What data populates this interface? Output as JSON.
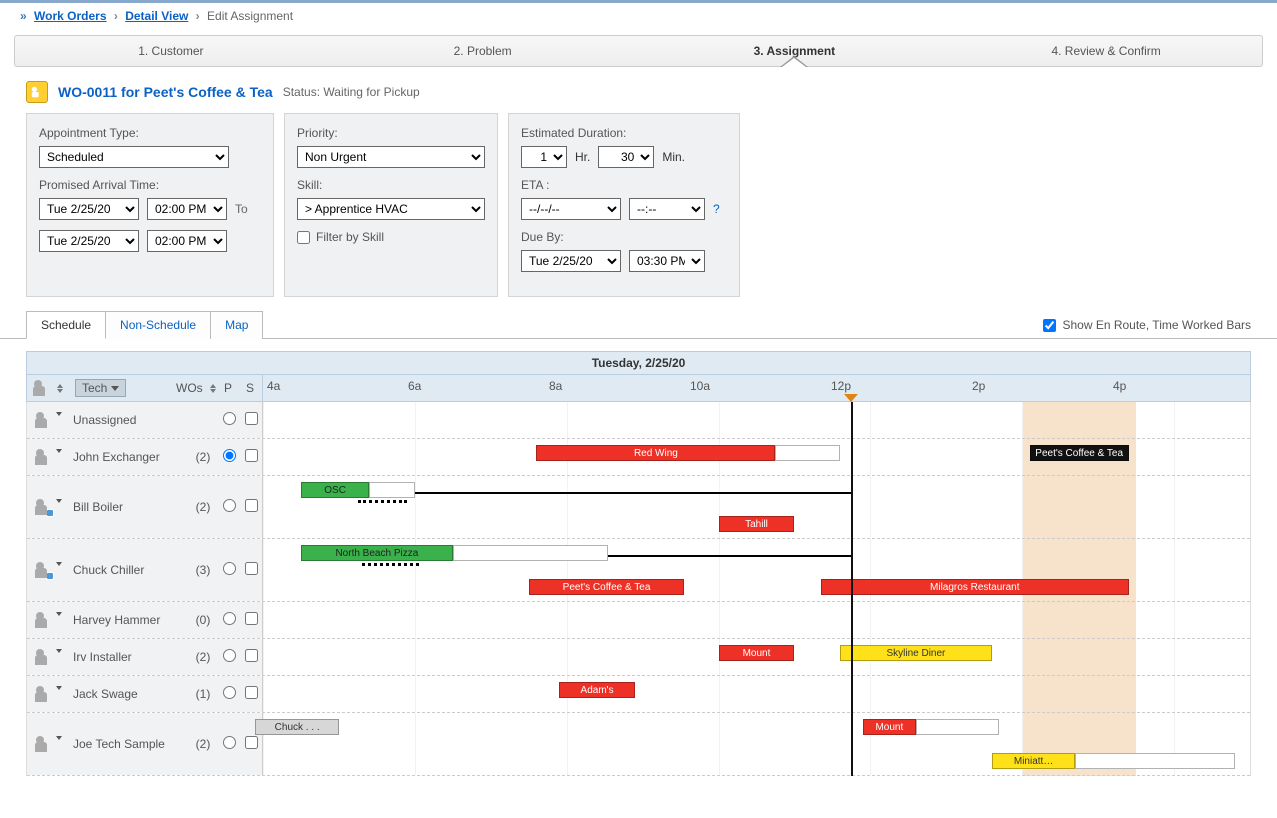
{
  "breadcrumbs": {
    "items": [
      {
        "label": "Work Orders",
        "link": true
      },
      {
        "label": "Detail View",
        "link": true
      },
      {
        "label": "Edit Assignment",
        "link": false
      }
    ]
  },
  "steps": {
    "items": [
      {
        "label": "1. Customer"
      },
      {
        "label": "2. Problem"
      },
      {
        "label": "3. Assignment",
        "active": true
      },
      {
        "label": "4. Review & Confirm"
      }
    ]
  },
  "work_order": {
    "title": "WO-0011 for Peet's Coffee & Tea",
    "status_label": "Status:",
    "status_value": "Waiting for Pickup"
  },
  "panels": {
    "appointment": {
      "type_label": "Appointment Type:",
      "type_value": "Scheduled",
      "arrival_label": "Promised Arrival Time:",
      "from_date": "Tue 2/25/20",
      "from_time": "02:00 PM",
      "to_label": "To",
      "to_date": "Tue 2/25/20",
      "to_time": "02:00 PM"
    },
    "priority": {
      "priority_label": "Priority:",
      "priority_value": "Non Urgent",
      "skill_label": "Skill:",
      "skill_value": ">  Apprentice HVAC",
      "filter_label": "Filter by Skill"
    },
    "duration": {
      "dur_label": "Estimated Duration:",
      "dur_hr": "1",
      "hr_lbl": "Hr.",
      "dur_min": "30",
      "min_lbl": "Min.",
      "eta_label": "ETA :",
      "eta_date": "--/--/--",
      "eta_time": "--:--",
      "help": "?",
      "due_label": "Due By:",
      "due_date": "Tue 2/25/20",
      "due_time": "03:30 PM"
    }
  },
  "sched": {
    "tabs": [
      {
        "label": "Schedule",
        "active": true
      },
      {
        "label": "Non-Schedule"
      },
      {
        "label": "Map"
      }
    ],
    "show_bars_label": "Show En Route, Time Worked Bars",
    "day_title": "Tuesday, 2/25/20",
    "columns": {
      "tech": "Tech",
      "wos": "WOs",
      "p": "P",
      "s": "S"
    },
    "hours": [
      "4a",
      "6a",
      "8a",
      "10a",
      "12p",
      "2p",
      "4p"
    ],
    "time_start_hr": 4,
    "time_end_hr": 17,
    "now_hr": 11.75,
    "window": {
      "start_hr": 14.0,
      "end_hr": 15.5
    },
    "rows": [
      {
        "name": "Unassigned",
        "count": "",
        "selected": false,
        "bars": []
      },
      {
        "name": "John Exchanger",
        "count": "(2)",
        "selected": true,
        "bars": [
          {
            "color": "red",
            "label": "Red Wing",
            "start": 7.6,
            "end": 10.75,
            "y": 0
          },
          {
            "color": "white",
            "label": "",
            "start": 10.75,
            "end": 11.6,
            "y": 0
          },
          {
            "color": "black",
            "label": "Peet's Coffee & Tea",
            "start": 14.1,
            "end": 15.4,
            "y": 0
          }
        ]
      },
      {
        "name": "Bill Boiler",
        "count": "(2)",
        "badge": true,
        "tall": true,
        "lines": [
          {
            "type": "dotted",
            "start": 5.25,
            "end": 5.9,
            "y": 16
          },
          {
            "type": "solid",
            "start": 5.9,
            "end": 11.75,
            "y": 8
          }
        ],
        "bars": [
          {
            "color": "green",
            "label": "OSC",
            "start": 4.5,
            "end": 5.4,
            "y": 0
          },
          {
            "color": "white",
            "label": "",
            "start": 5.4,
            "end": 6.0,
            "y": 0
          },
          {
            "color": "red",
            "label": "Tahill",
            "start": 10.0,
            "end": 11.0,
            "y": 34
          }
        ]
      },
      {
        "name": "Chuck Chiller",
        "count": "(3)",
        "badge": true,
        "tall": true,
        "lines": [
          {
            "type": "dotted",
            "start": 5.3,
            "end": 6.05,
            "y": 16
          },
          {
            "type": "solid",
            "start": 6.1,
            "end": 11.75,
            "y": 8
          }
        ],
        "bars": [
          {
            "color": "green",
            "label": "North Beach Pizza",
            "start": 4.5,
            "end": 6.5,
            "y": 0
          },
          {
            "color": "white",
            "label": "",
            "start": 6.5,
            "end": 8.55,
            "y": 0
          },
          {
            "color": "red",
            "label": "Peet's Coffee & Tea",
            "start": 7.5,
            "end": 9.55,
            "y": 34
          },
          {
            "color": "red",
            "label": "Milagros Restaurant",
            "start": 11.35,
            "end": 15.4,
            "y": 34
          }
        ]
      },
      {
        "name": "Harvey Hammer",
        "count": "(0)",
        "bars": []
      },
      {
        "name": "Irv Installer",
        "count": "(2)",
        "bars": [
          {
            "color": "red",
            "label": "Mount",
            "start": 10.0,
            "end": 11.0,
            "y": 0
          },
          {
            "color": "yellow",
            "label": "Skyline Diner",
            "start": 11.6,
            "end": 13.6,
            "y": 0
          }
        ]
      },
      {
        "name": "Jack Swage",
        "count": "(1)",
        "bars": [
          {
            "color": "red",
            "label": "Adam's",
            "start": 7.9,
            "end": 8.9,
            "y": 0
          }
        ]
      },
      {
        "name": "Joe Tech Sample",
        "count": "(2)",
        "tall": true,
        "bars": [
          {
            "color": "gray",
            "label": "Chuck . . .",
            "start": 3.9,
            "end": 5.0,
            "y": 0
          },
          {
            "color": "red",
            "label": "Mount",
            "start": 11.9,
            "end": 12.6,
            "y": 0
          },
          {
            "color": "white",
            "label": "",
            "start": 12.6,
            "end": 13.7,
            "y": 0
          },
          {
            "color": "yellow",
            "label": "Miniatt…",
            "start": 13.6,
            "end": 14.7,
            "y": 34
          },
          {
            "color": "white",
            "label": "",
            "start": 14.7,
            "end": 16.8,
            "y": 34
          }
        ]
      }
    ]
  }
}
